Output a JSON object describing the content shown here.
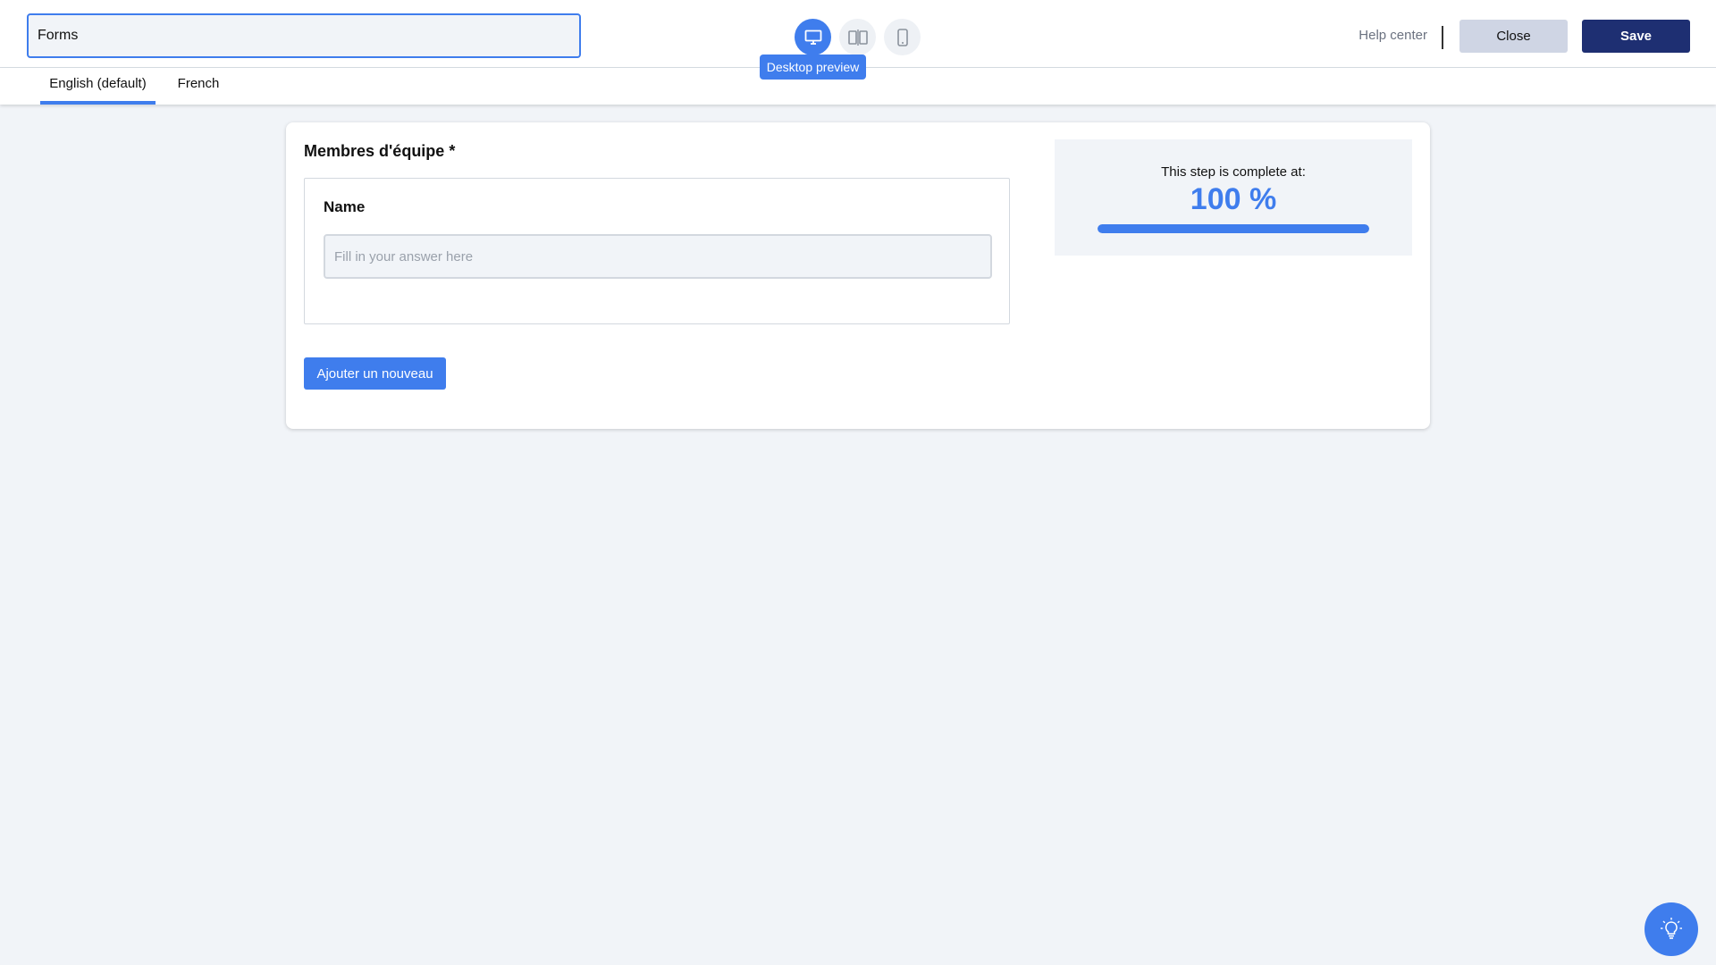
{
  "header": {
    "form_title_value": "Forms",
    "preview_buttons": [
      {
        "icon": "desktop-icon",
        "active": true
      },
      {
        "icon": "split-view-icon",
        "active": false
      },
      {
        "icon": "mobile-icon",
        "active": false
      }
    ],
    "tooltip_text": "Desktop preview",
    "help_label": "Help center",
    "close_label": "Close",
    "save_label": "Save"
  },
  "tabs": [
    {
      "label": "English (default)",
      "active": true
    },
    {
      "label": "French",
      "active": false
    }
  ],
  "card": {
    "section_title": "Membres d'équipe *",
    "field": {
      "label": "Name",
      "placeholder": "Fill in your answer here",
      "value": ""
    },
    "add_button_label": "Ajouter un nouveau",
    "progress": {
      "caption": "This step is complete at:",
      "value_text": "100 %",
      "percent": 100
    }
  },
  "fab": {
    "icon": "lightbulb-icon"
  },
  "colors": {
    "accent": "#3f7ded",
    "save_button": "#1e2f72",
    "close_button": "#cfd5e4",
    "background": "#f1f4f8"
  }
}
